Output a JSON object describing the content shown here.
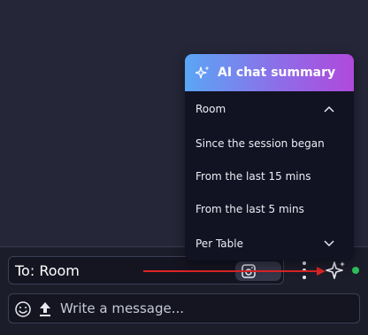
{
  "recipient": {
    "label": "To: Room"
  },
  "composer": {
    "placeholder": "Write a message..."
  },
  "ai_summary": {
    "title": "AI chat summary",
    "items": [
      {
        "label": "Room",
        "chevron": "up"
      },
      {
        "label": "Since the session began"
      },
      {
        "label": "From the last 15 mins"
      },
      {
        "label": "From the last 5 mins"
      },
      {
        "label": "Per Table",
        "chevron": "down"
      }
    ]
  },
  "icons": {
    "sparkle": "sparkle-icon",
    "kebab": "kebab-menu-icon",
    "emoji": "emoji-icon",
    "upload": "upload-icon",
    "camera": "camera-icon"
  },
  "colors": {
    "gradient_start": "#5aa6f5",
    "gradient_end": "#b049dc",
    "online": "#2fbf5a",
    "annotation_arrow": "#e02424"
  }
}
